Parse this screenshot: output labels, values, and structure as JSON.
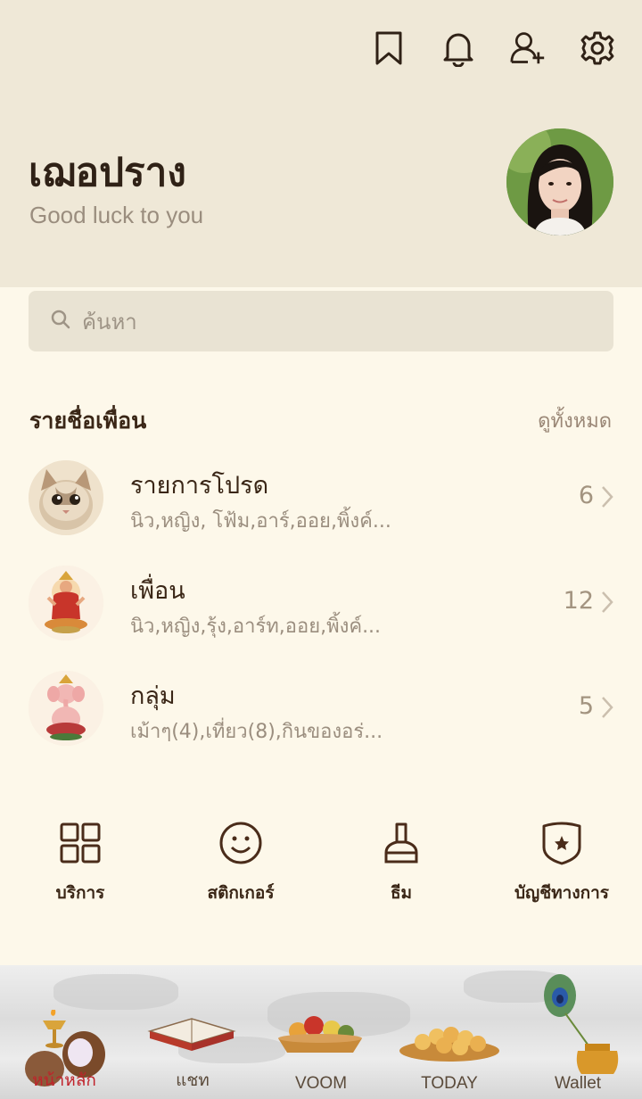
{
  "profile": {
    "name": "เฌอปราง",
    "status_message": "Good luck to you"
  },
  "header_icons": [
    "bookmark-icon",
    "bell-icon",
    "add-friend-icon",
    "settings-icon"
  ],
  "search": {
    "placeholder": "ค้นหา"
  },
  "friends_section": {
    "title": "รายชื่อเพื่อน",
    "see_all": "ดูทั้งหมด",
    "rows": [
      {
        "title": "รายการโปรด",
        "subtitle": "นิว,หญิง, โฟ้ม,อาร์,ออย,พิ้งค์...",
        "count": "6"
      },
      {
        "title": "เพื่อน",
        "subtitle": "นิว,หญิง,รุ้ง,อาร์ท,ออย,พิ้งค์...",
        "count": "12"
      },
      {
        "title": "กลุ่ม",
        "subtitle": "เม้าๆ(4),เที่ยว(8),กินของอร่...",
        "count": "5"
      }
    ]
  },
  "quick_actions": [
    {
      "label": "บริการ",
      "icon": "grid-icon"
    },
    {
      "label": "สติกเกอร์",
      "icon": "smile-icon"
    },
    {
      "label": "ธีม",
      "icon": "brush-icon"
    },
    {
      "label": "บัญชีทางการ",
      "icon": "shield-star-icon"
    }
  ],
  "tabs": [
    {
      "label": "หน้าหลัก",
      "active": true
    },
    {
      "label": "แชท",
      "active": false
    },
    {
      "label": "VOOM",
      "active": false
    },
    {
      "label": "TODAY",
      "active": false
    },
    {
      "label": "Wallet",
      "active": false
    }
  ],
  "colors": {
    "header_bg": "#efe8d7",
    "page_bg": "#fdf8ea",
    "active_tab": "#c0222a",
    "text_dark": "#3a2616"
  }
}
